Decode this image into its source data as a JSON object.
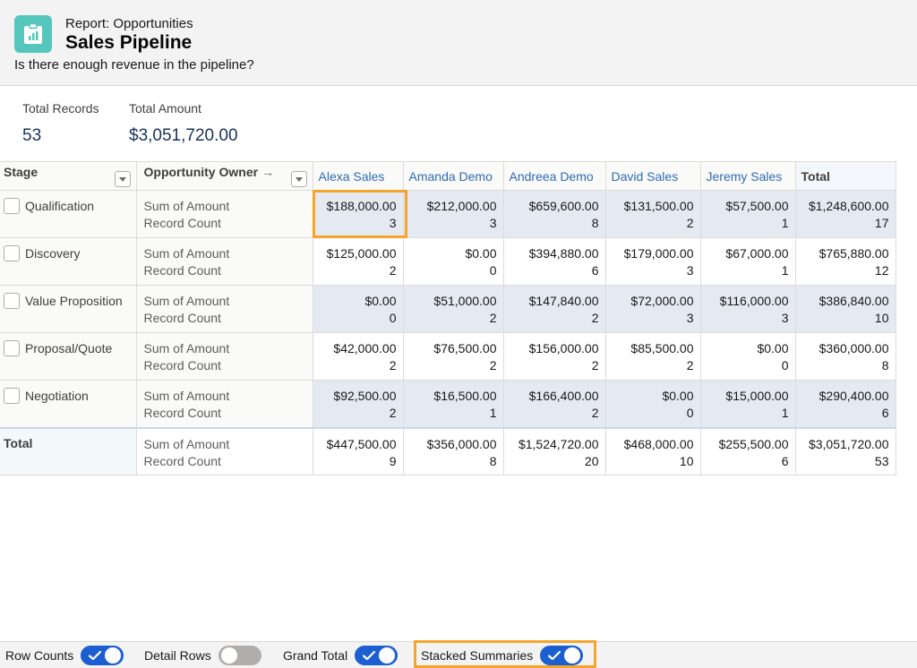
{
  "header": {
    "report_type": "Report: Opportunities",
    "title": "Sales Pipeline",
    "description": "Is there enough revenue in the pipeline?",
    "icon": "report-chart-icon",
    "icon_color": "#54c6bb"
  },
  "summary": {
    "total_records_label": "Total Records",
    "total_records_value": "53",
    "total_amount_label": "Total Amount",
    "total_amount_value": "$3,051,720.00"
  },
  "table": {
    "stage_header": "Stage",
    "owner_header": "Opportunity Owner",
    "owner_arrow": "→",
    "columns": [
      "Alexa Sales",
      "Amanda Demo",
      "Andreea Demo",
      "David Sales",
      "Jeremy Sales",
      "Total"
    ],
    "sum_label": "Sum of Amount",
    "count_label": "Record Count",
    "rows": [
      {
        "stage": "Qualification",
        "cells": [
          {
            "amount": "$188,000.00",
            "count": "3"
          },
          {
            "amount": "$212,000.00",
            "count": "3"
          },
          {
            "amount": "$659,600.00",
            "count": "8"
          },
          {
            "amount": "$131,500.00",
            "count": "2"
          },
          {
            "amount": "$57,500.00",
            "count": "1"
          },
          {
            "amount": "$1,248,600.00",
            "count": "17"
          }
        ]
      },
      {
        "stage": "Discovery",
        "cells": [
          {
            "amount": "$125,000.00",
            "count": "2"
          },
          {
            "amount": "$0.00",
            "count": "0"
          },
          {
            "amount": "$394,880.00",
            "count": "6"
          },
          {
            "amount": "$179,000.00",
            "count": "3"
          },
          {
            "amount": "$67,000.00",
            "count": "1"
          },
          {
            "amount": "$765,880.00",
            "count": "12"
          }
        ]
      },
      {
        "stage": "Value Proposition",
        "cells": [
          {
            "amount": "$0.00",
            "count": "0"
          },
          {
            "amount": "$51,000.00",
            "count": "2"
          },
          {
            "amount": "$147,840.00",
            "count": "2"
          },
          {
            "amount": "$72,000.00",
            "count": "3"
          },
          {
            "amount": "$116,000.00",
            "count": "3"
          },
          {
            "amount": "$386,840.00",
            "count": "10"
          }
        ]
      },
      {
        "stage": "Proposal/Quote",
        "cells": [
          {
            "amount": "$42,000.00",
            "count": "2"
          },
          {
            "amount": "$76,500.00",
            "count": "2"
          },
          {
            "amount": "$156,000.00",
            "count": "2"
          },
          {
            "amount": "$85,500.00",
            "count": "2"
          },
          {
            "amount": "$0.00",
            "count": "0"
          },
          {
            "amount": "$360,000.00",
            "count": "8"
          }
        ]
      },
      {
        "stage": "Negotiation",
        "cells": [
          {
            "amount": "$92,500.00",
            "count": "2"
          },
          {
            "amount": "$16,500.00",
            "count": "1"
          },
          {
            "amount": "$166,400.00",
            "count": "2"
          },
          {
            "amount": "$0.00",
            "count": "0"
          },
          {
            "amount": "$15,000.00",
            "count": "1"
          },
          {
            "amount": "$290,400.00",
            "count": "6"
          }
        ]
      }
    ],
    "total_row": {
      "stage": "Total",
      "cells": [
        {
          "amount": "$447,500.00",
          "count": "9"
        },
        {
          "amount": "$356,000.00",
          "count": "8"
        },
        {
          "amount": "$1,524,720.00",
          "count": "20"
        },
        {
          "amount": "$468,000.00",
          "count": "10"
        },
        {
          "amount": "$255,500.00",
          "count": "6"
        },
        {
          "amount": "$3,051,720.00",
          "count": "53"
        }
      ]
    }
  },
  "footer": {
    "row_counts_label": "Row Counts",
    "row_counts_on": true,
    "detail_rows_label": "Detail Rows",
    "detail_rows_on": false,
    "grand_total_label": "Grand Total",
    "grand_total_on": true,
    "stacked_summaries_label": "Stacked Summaries",
    "stacked_summaries_on": true
  },
  "colors": {
    "accent_blue": "#1b5fd0",
    "link_blue": "#2e6bb5",
    "highlight_orange": "#f4a52a",
    "shaded_cell": "#e5eaf2"
  }
}
